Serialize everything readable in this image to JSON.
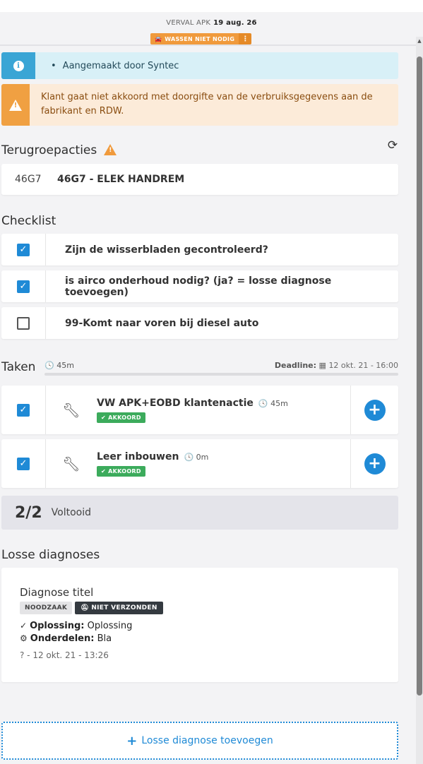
{
  "header": {
    "apk_label": "VERVAL APK",
    "apk_value": "19 aug. 26",
    "wash_badge": "WASSEN NIET NODIG",
    "wash_more": "⋮",
    "accent": "#f09a3c"
  },
  "alerts": {
    "info_text": "Aangemaakt door Syntec",
    "warning_text": "Klant gaat niet akkoord met doorgifte van de verbruiksgegevens aan de fabrikant en RDW."
  },
  "recalls": {
    "title": "Terugroepacties",
    "items": [
      {
        "code": "46G7",
        "name": "46G7 - ELEK HANDREM"
      }
    ]
  },
  "checklist": {
    "title": "Checklist",
    "items": [
      {
        "label": "Zijn de wisserbladen gecontroleerd?",
        "checked": true
      },
      {
        "label": "is airco onderhoud nodig? (ja? = losse diagnose toevoegen)",
        "checked": true
      },
      {
        "label": "99-Komt naar voren bij diesel auto",
        "checked": false
      }
    ]
  },
  "tasks": {
    "title": "Taken",
    "total_duration": "45m",
    "deadline_label": "Deadline:",
    "deadline_value": "12 okt. 21 - 16:00",
    "items": [
      {
        "name": "VW APK+EOBD klantenactie",
        "duration": "45m",
        "status": "AKKOORD",
        "checked": true
      },
      {
        "name": "Leer inbouwen",
        "duration": "0m",
        "status": "AKKOORD",
        "checked": true
      }
    ],
    "done_count": "2/2",
    "done_label": "Voltooid"
  },
  "diagnoses": {
    "title": "Losse diagnoses",
    "items": [
      {
        "title": "Diagnose titel",
        "badge_priority": "NOODZAAK",
        "badge_status": "NIET VERZONDEN",
        "solution_label": "Oplossing:",
        "solution_value": "Oplossing",
        "parts_label": "Onderdelen:",
        "parts_value": "Bla",
        "meta": "? - 12 okt. 21 - 13:26"
      }
    ],
    "add_label": "Losse diagnose toevoegen"
  },
  "colors": {
    "primary": "#1f8ad6",
    "success": "#3cab5c",
    "info": "#3aa5d5",
    "warning": "#f0a042"
  }
}
